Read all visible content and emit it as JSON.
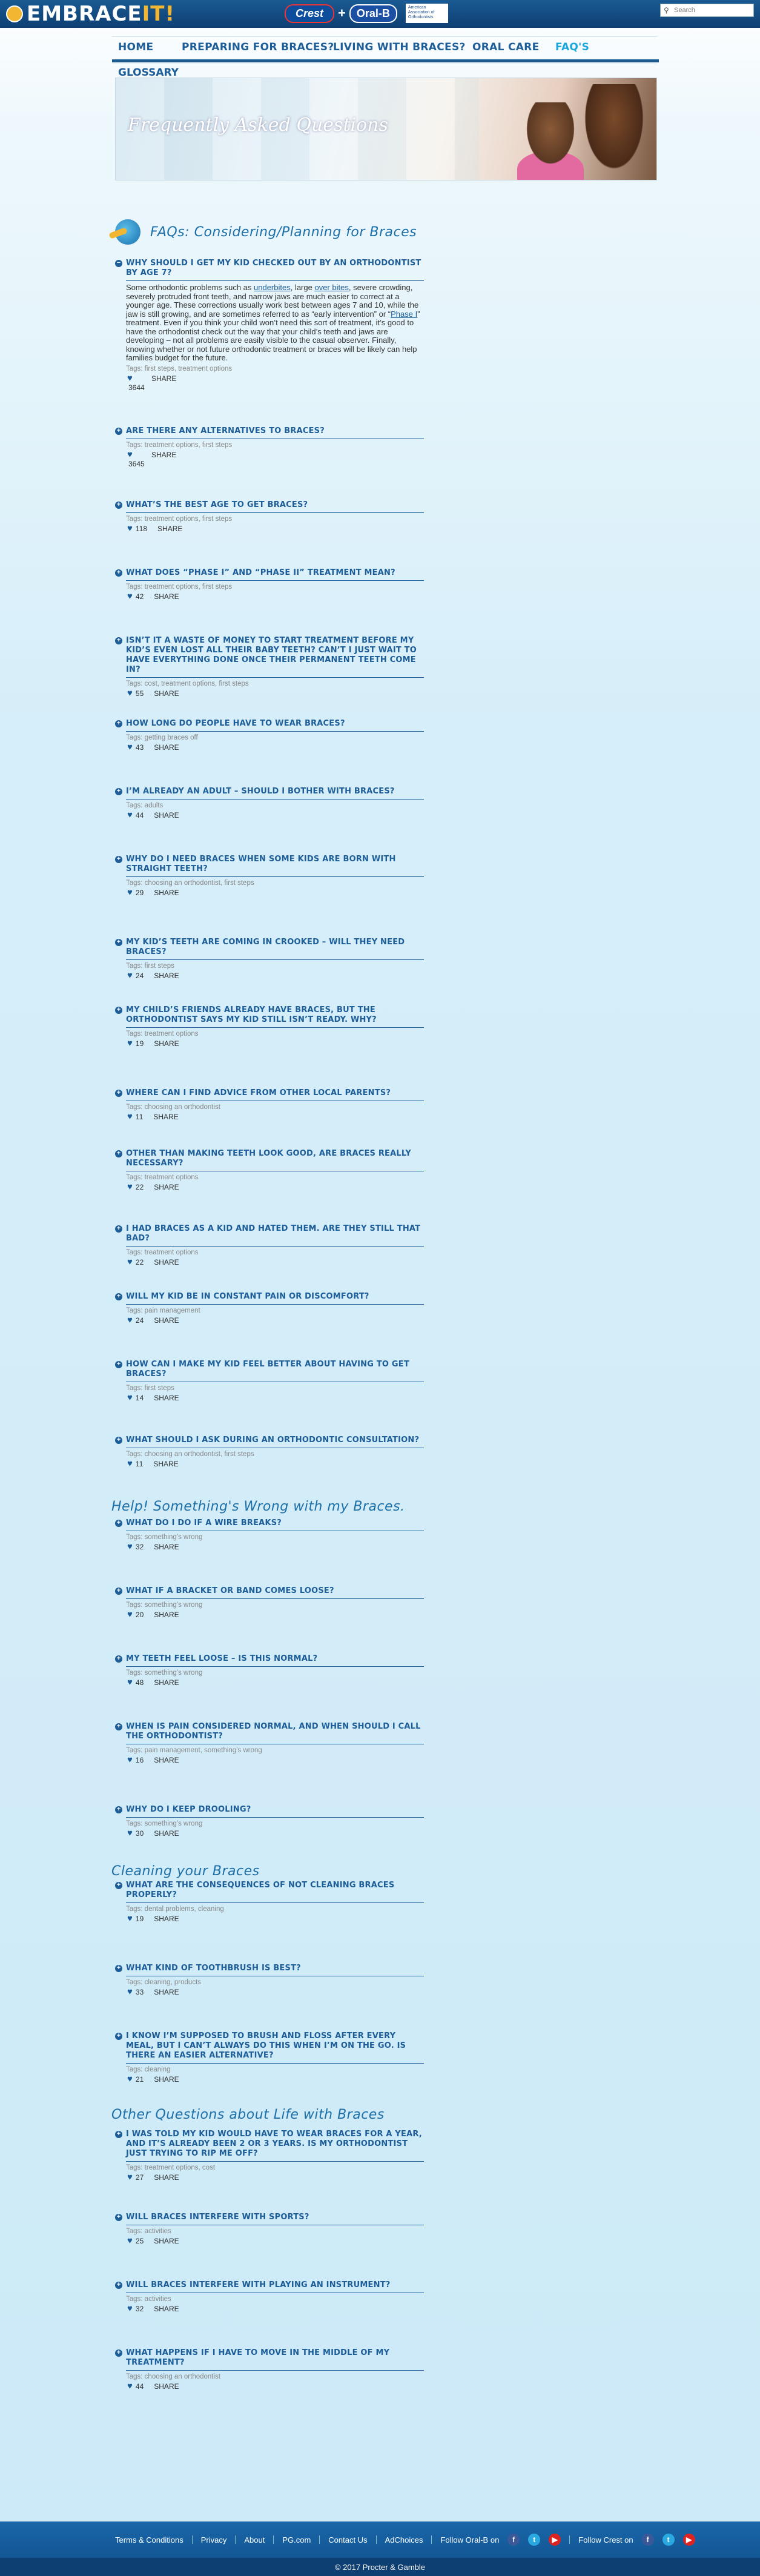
{
  "header": {
    "logo_main": "EMBRACE",
    "logo_accent": "IT!",
    "brand1": "Crest",
    "brand_plus": "+",
    "brand2": "Oral-B",
    "ada_text": "American Association of Orthodontists",
    "search_placeholder": "Search"
  },
  "nav": {
    "items": [
      "HOME",
      "PREPARING FOR BRACES?",
      "LIVING WITH BRACES?",
      "ORAL CARE",
      "FAQ'S"
    ],
    "active": "FAQ'S",
    "glossary": "GLOSSARY"
  },
  "hero": {
    "title": "Frequently Asked Questions"
  },
  "sections": [
    {
      "title": "FAQs: Considering/Planning for Braces"
    },
    {
      "title": "Help! Something's Wrong with my Braces."
    },
    {
      "title": "Cleaning your Braces"
    },
    {
      "title": "Other Questions about Life with Braces"
    }
  ],
  "first_answer": {
    "p1": "Some orthodontic problems such as ",
    "link1": "underbites",
    "p2": ", large ",
    "link2": "over bites",
    "p3": ", severe crowding, severely protruded front teeth, and narrow jaws are much easier to correct at a younger age. These corrections usually work best between ages 7 and 10, while the jaw is still growing, and are sometimes referred to as “early intervention” or “",
    "link3": "Phase I",
    "p4": "” treatment. Even if you think your child won’t need this sort of treatment, it’s good to have the orthodontist check out the way that your child’s teeth and jaws are developing – not all problems are easily visible to the casual observer. Finally, knowing whether or not future orthodontic treatment or braces will be likely can help families budget for the future."
  },
  "share_label": "SHARE",
  "questions": [
    {
      "q": "Why should I get my kid checked out by an orthodontist by age 7?",
      "tags": "Tags: first steps, treatment options",
      "count": "3644",
      "open": true
    },
    {
      "q": "Are there any alternatives to braces?",
      "tags": "Tags: treatment options, first steps",
      "count": "3645"
    },
    {
      "q": "What’s the best age to get braces?",
      "tags": "Tags: treatment options, first steps",
      "count": "118"
    },
    {
      "q": "What does “Phase I” and “Phase II” treatment mean?",
      "tags": "Tags: treatment options, first steps",
      "count": "42"
    },
    {
      "q": "Isn’t it a waste of money to start treatment before my kid’s even lost all their baby teeth? Can’t I just wait to have everything done once their permanent teeth come in?",
      "tags": "Tags: cost, treatment options, first steps",
      "count": "55"
    },
    {
      "q": "How long do people have to wear braces?",
      "tags": "Tags: getting braces off",
      "count": "43"
    },
    {
      "q": "I’m already an adult – should I bother with braces?",
      "tags": "Tags: adults",
      "count": "44"
    },
    {
      "q": "Why do I need braces when some kids are born with straight teeth?",
      "tags": "Tags: choosing an orthodontist, first steps",
      "count": "29"
    },
    {
      "q": "My kid’s teeth are coming in crooked – will they need braces?",
      "tags": "Tags: first steps",
      "count": "24"
    },
    {
      "q": "My child’s friends already have braces, but the orthodontist says my kid still isn’t ready. Why?",
      "tags": "Tags: treatment options",
      "count": "19"
    },
    {
      "q": "Where can I find advice from other local parents?",
      "tags": "Tags: choosing an orthodontist",
      "count": "11"
    },
    {
      "q": "Other than making teeth look good, are braces really necessary?",
      "tags": "Tags: treatment options",
      "count": "22"
    },
    {
      "q": "I had braces as a kid and hated them. Are they still that bad?",
      "tags": "Tags: treatment options",
      "count": "22"
    },
    {
      "q": "Will my kid be in constant pain or discomfort?",
      "tags": "Tags: pain management",
      "count": "24"
    },
    {
      "q": "How can I make my kid feel better about having to get braces?",
      "tags": "Tags: first steps",
      "count": "14"
    },
    {
      "q": "What should I ask during an orthodontic consultation?",
      "tags": "Tags: choosing an orthodontist, first steps",
      "count": "11"
    },
    {
      "q": "What do I do if a wire breaks?",
      "tags": "Tags: something’s wrong",
      "count": "32"
    },
    {
      "q": "What if a bracket or band comes loose?",
      "tags": "Tags: something’s wrong",
      "count": "20"
    },
    {
      "q": "My teeth feel loose – is this normal?",
      "tags": "Tags: something’s wrong",
      "count": "48"
    },
    {
      "q": "When is pain considered normal, and when should I call the orthodontist?",
      "tags": "Tags: pain management, something’s wrong",
      "count": "16"
    },
    {
      "q": "Why do I keep drooling?",
      "tags": "Tags: something’s wrong",
      "count": "30"
    },
    {
      "q": "What are the consequences of not cleaning braces properly?",
      "tags": "Tags: dental problems, cleaning",
      "count": "19"
    },
    {
      "q": "What kind of toothbrush is best?",
      "tags": "Tags: cleaning, products",
      "count": "33"
    },
    {
      "q": "I know I’m supposed to brush and floss after every meal, but I can’t always do this when I’m on the go. Is there an easier alternative?",
      "tags": "Tags: cleaning",
      "count": "21"
    },
    {
      "q": "I was told my kid would have to wear braces for a year, and it’s already been 2 or 3 years. Is my orthodontist just trying to rip me off?",
      "tags": "Tags: treatment options, cost",
      "count": "27"
    },
    {
      "q": "Will braces interfere with sports?",
      "tags": "Tags: activities",
      "count": "25"
    },
    {
      "q": "Will braces interfere with playing an instrument?",
      "tags": "Tags: activities",
      "count": "32"
    },
    {
      "q": "What happens if I have to move in the middle of my treatment?",
      "tags": "Tags: choosing an orthodontist",
      "count": "44"
    }
  ],
  "footer": {
    "links": [
      "Terms & Conditions",
      "Privacy",
      "About",
      "PG.com",
      "Contact Us",
      "AdChoices"
    ],
    "follow_oralb": "Follow Oral-B on",
    "follow_crest": "Follow Crest on",
    "copyright": "© 2017 Procter & Gamble"
  }
}
